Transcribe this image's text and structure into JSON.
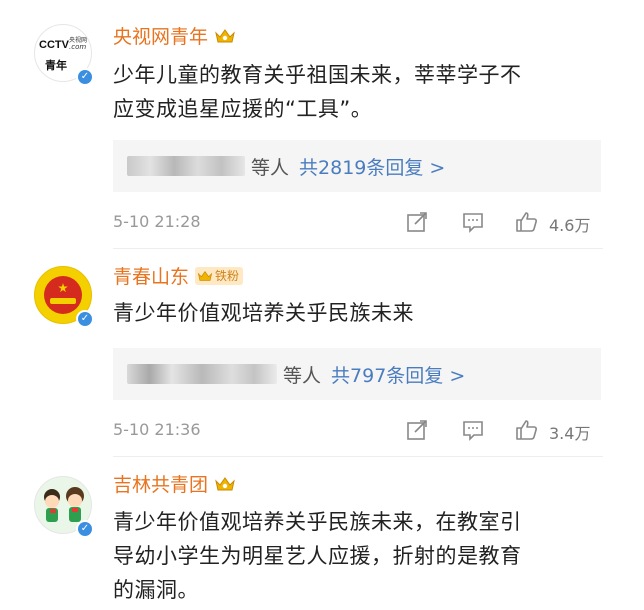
{
  "comments": [
    {
      "name": "央视网青年",
      "avatar_text_line1": "CCTV",
      "avatar_text_line2": "青年",
      "avatar_text_small": "央视网",
      "avatar_text_com": ".com",
      "text_lines": [
        "少年儿童的教育关乎祖国未来，莘莘学子不",
        "应变成追星应援的“工具”。"
      ],
      "reply_people": "等人",
      "reply_count": "共2819条回复 >",
      "time": "5-10 21:28",
      "likes": "4.6万"
    },
    {
      "name": "青春山东",
      "badge": "铁粉",
      "text_lines": [
        "青少年价值观培养关乎民族未来"
      ],
      "reply_people": "等人",
      "reply_count": "共797条回复 >",
      "time": "5-10 21:36",
      "likes": "3.4万"
    },
    {
      "name": "吉林共青团",
      "text_lines": [
        "青少年价值观培养关乎民族未来，在教室引",
        "导幼小学生为明星艺人应援，折射的是教育",
        "的漏洞。"
      ]
    }
  ],
  "colors": {
    "name": "#e8741f",
    "link": "#4a7dbf",
    "verified": "#3b8fe0",
    "crown": "#f0b400"
  }
}
